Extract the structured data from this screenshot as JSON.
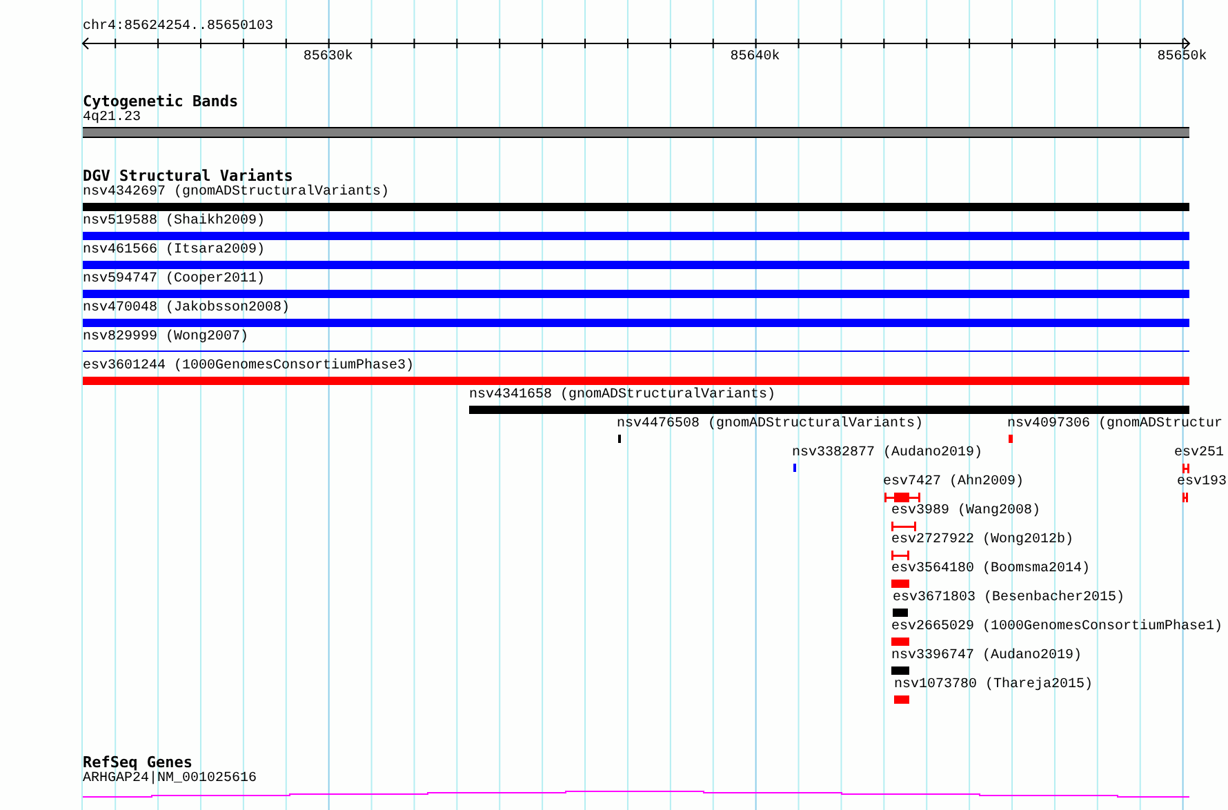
{
  "ruler": {
    "location": "chr4:85624254..85650103",
    "tick_labels": [
      "85630k",
      "85640k",
      "85650k"
    ]
  },
  "cytogenetic_bands": {
    "title": "Cytogenetic Bands",
    "band": "4q21.23"
  },
  "dgv": {
    "title": "DGV Structural Variants",
    "features": [
      {
        "label": "nsv4342697 (gnomADStructuralVariants)",
        "color": "#000000",
        "kind": "bar"
      },
      {
        "label": "nsv519588 (Shaikh2009)",
        "color": "#0000ff",
        "kind": "bar"
      },
      {
        "label": "nsv461566 (Itsara2009)",
        "color": "#0000ff",
        "kind": "bar"
      },
      {
        "label": "nsv594747 (Cooper2011)",
        "color": "#0000ff",
        "kind": "bar"
      },
      {
        "label": "nsv470048 (Jakobsson2008)",
        "color": "#0000ff",
        "kind": "bar"
      },
      {
        "label": "nsv829999 (Wong2007)",
        "color": "#0000ff",
        "kind": "line"
      },
      {
        "label": "esv3601244 (1000GenomesConsortiumPhase3)",
        "color": "#ff0000",
        "kind": "bar"
      },
      {
        "label": "nsv4341658 (gnomADStructuralVariants)",
        "color": "#000000",
        "kind": "bar"
      },
      {
        "label": "nsv4476508 (gnomADStructuralVariants)",
        "color": "#000000",
        "kind": "bar"
      },
      {
        "label": "nsv4097306 (gnomADStructur",
        "color": "#ff0000",
        "kind": "bar"
      },
      {
        "label": "nsv3382877 (Audano2019)",
        "color": "#0000ff",
        "kind": "bar"
      },
      {
        "label": "esv251",
        "color": "#ff0000",
        "kind": "span"
      },
      {
        "label": "esv7427 (Ahn2009)",
        "color": "#ff0000",
        "kind": "span_box"
      },
      {
        "label": "esv193",
        "color": "#ff0000",
        "kind": "span"
      },
      {
        "label": "esv3989 (Wang2008)",
        "color": "#ff0000",
        "kind": "span"
      },
      {
        "label": "esv2727922 (Wong2012b)",
        "color": "#ff0000",
        "kind": "span"
      },
      {
        "label": "esv3564180 (Boomsma2014)",
        "color": "#ff0000",
        "kind": "bar"
      },
      {
        "label": "esv3671803 (Besenbacher2015)",
        "color": "#000000",
        "kind": "bar"
      },
      {
        "label": "esv2665029 (1000GenomesConsortiumPhase1)",
        "color": "#ff0000",
        "kind": "bar"
      },
      {
        "label": "nsv3396747 (Audano2019)",
        "color": "#000000",
        "kind": "bar"
      },
      {
        "label": "nsv1073780 (Thareja2015)",
        "color": "#ff0000",
        "kind": "bar"
      }
    ]
  },
  "refseq_genes": {
    "title": "RefSeq Genes",
    "gene": "ARHGAP24|NM_001025616"
  }
}
